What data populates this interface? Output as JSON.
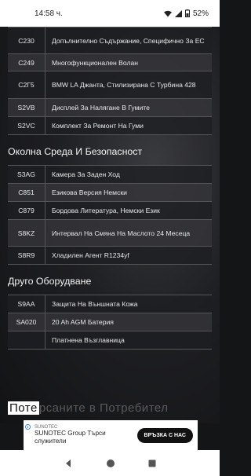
{
  "status_bar": {
    "time": "14:58 ч.",
    "battery": "52%"
  },
  "table_top": [
    {
      "code": "C230",
      "desc": "Допълнително Съдържание, Специфично За ЕС"
    },
    {
      "code": "C249",
      "desc": "Многофункционален Волан"
    },
    {
      "code": "C2Г5",
      "desc": "BMW LA Джанта, Стилизирана С Турбина 428"
    },
    {
      "code": "S2VB",
      "desc": "Дисплей За Налягане В Гумите"
    },
    {
      "code": "S2VC",
      "desc": "Комплект За Ремонт На Гуми"
    }
  ],
  "section_environment": {
    "title": "Околна Среда И Безопасност",
    "rows": [
      {
        "code": "S3AG",
        "desc": "Камера За Заден Ход"
      },
      {
        "code": "C851",
        "desc": "Езикова Версия Немски"
      },
      {
        "code": "C879",
        "desc": "Бордова Литература, Немски Език"
      },
      {
        "code": "S8KZ",
        "desc": "Интервал На Смяна На Маслото 24 Месеца"
      },
      {
        "code": "S8R9",
        "desc": "Хладилен Агент R1234yf"
      }
    ]
  },
  "section_other": {
    "title": "Друго Оборудване",
    "rows": [
      {
        "code": "S9AA",
        "desc": "Защита На Външната Кожа"
      },
      {
        "code": "SA020",
        "desc": "20 Ah AGM Батерия"
      },
      {
        "code": "",
        "desc": "Платнена Възглавница"
      }
    ]
  },
  "overlay": {
    "lead": "Поте",
    "rest": "рсаните в Потребител"
  },
  "ad": {
    "brand": "SUNOTEC",
    "headline": "SUNOTEC Group Търси служители",
    "cta": "ВРЪЗКА С НАС"
  },
  "colors": {
    "background": "#141517",
    "row_dark": "#1e1f22",
    "row_light": "#343539",
    "border": "#555555"
  },
  "icons": [
    "wifi-icon",
    "signal-icon",
    "battery-icon",
    "back-icon",
    "home-icon",
    "recents-icon",
    "ad-info-icon"
  ]
}
